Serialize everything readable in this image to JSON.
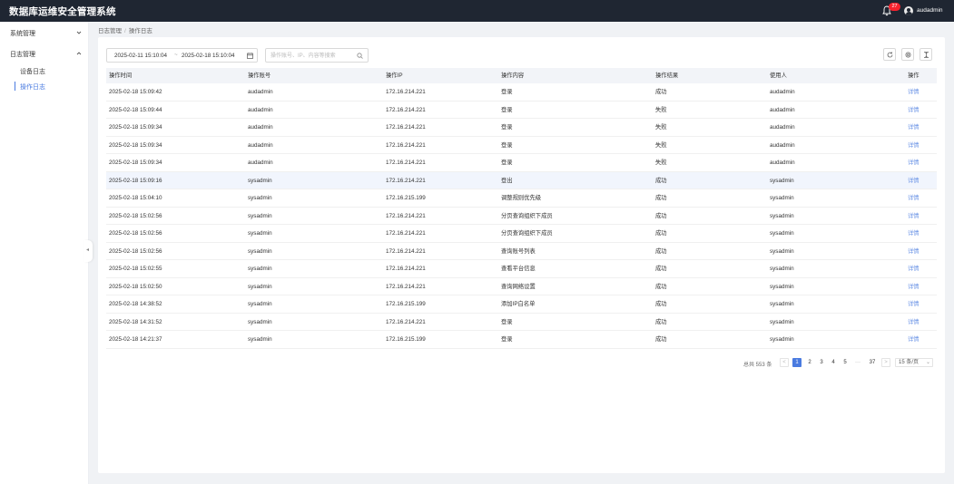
{
  "header": {
    "app_title": "数据库运维安全管理系统",
    "notification_count": "27",
    "username": "audadmin"
  },
  "sidebar": {
    "groups": [
      {
        "label": "系统管理",
        "expanded": false,
        "items": []
      },
      {
        "label": "日志管理",
        "expanded": true,
        "items": [
          {
            "label": "设备日志",
            "active": false
          },
          {
            "label": "操作日志",
            "active": true
          }
        ]
      }
    ],
    "collapse_icon": "chevron-left-icon"
  },
  "breadcrumb": {
    "parent": "日志管理",
    "separator": "/",
    "current": "操作日志"
  },
  "filters": {
    "date_start": "2025-02-11 15:10:04",
    "date_separator": "~",
    "date_end": "2025-02-18 15:10:04",
    "search_placeholder": "操作账号、IP、内容等搜索",
    "search_value": ""
  },
  "toolbar": {
    "refresh_icon": "refresh-icon",
    "settings_icon": "settings-icon",
    "column_height_icon": "column-height-icon"
  },
  "table": {
    "columns": [
      "操作时间",
      "操作账号",
      "操作IP",
      "操作内容",
      "操作结果",
      "使用人",
      "操作"
    ],
    "rows": [
      {
        "time": "2025-02-18 15:09:42",
        "account": "audadmin",
        "ip": "172.16.214.221",
        "content": "登录",
        "result": "成功",
        "user": "audadmin",
        "action": "详情"
      },
      {
        "time": "2025-02-18 15:09:44",
        "account": "audadmin",
        "ip": "172.16.214.221",
        "content": "登录",
        "result": "失败",
        "user": "audadmin",
        "action": "详情"
      },
      {
        "time": "2025-02-18 15:09:34",
        "account": "audadmin",
        "ip": "172.16.214.221",
        "content": "登录",
        "result": "失败",
        "user": "audadmin",
        "action": "详情"
      },
      {
        "time": "2025-02-18 15:09:34",
        "account": "audadmin",
        "ip": "172.16.214.221",
        "content": "登录",
        "result": "失败",
        "user": "audadmin",
        "action": "详情"
      },
      {
        "time": "2025-02-18 15:09:34",
        "account": "audadmin",
        "ip": "172.16.214.221",
        "content": "登录",
        "result": "失败",
        "user": "audadmin",
        "action": "详情"
      },
      {
        "time": "2025-02-18 15:09:16",
        "account": "sysadmin",
        "ip": "172.16.214.221",
        "content": "登出",
        "result": "成功",
        "user": "sysadmin",
        "action": "详情"
      },
      {
        "time": "2025-02-18 15:04:10",
        "account": "sysadmin",
        "ip": "172.16.215.199",
        "content": "调整规则优先级",
        "result": "成功",
        "user": "sysadmin",
        "action": "详情"
      },
      {
        "time": "2025-02-18 15:02:56",
        "account": "sysadmin",
        "ip": "172.16.214.221",
        "content": "分页查询组织下成员",
        "result": "成功",
        "user": "sysadmin",
        "action": "详情"
      },
      {
        "time": "2025-02-18 15:02:56",
        "account": "sysadmin",
        "ip": "172.16.214.221",
        "content": "分页查询组织下成员",
        "result": "成功",
        "user": "sysadmin",
        "action": "详情"
      },
      {
        "time": "2025-02-18 15:02:56",
        "account": "sysadmin",
        "ip": "172.16.214.221",
        "content": "查询账号列表",
        "result": "成功",
        "user": "sysadmin",
        "action": "详情"
      },
      {
        "time": "2025-02-18 15:02:55",
        "account": "sysadmin",
        "ip": "172.16.214.221",
        "content": "查看平台信息",
        "result": "成功",
        "user": "sysadmin",
        "action": "详情"
      },
      {
        "time": "2025-02-18 15:02:50",
        "account": "sysadmin",
        "ip": "172.16.214.221",
        "content": "查询网络设置",
        "result": "成功",
        "user": "sysadmin",
        "action": "详情"
      },
      {
        "time": "2025-02-18 14:38:52",
        "account": "sysadmin",
        "ip": "172.16.215.199",
        "content": "添加IP白名单",
        "result": "成功",
        "user": "sysadmin",
        "action": "详情"
      },
      {
        "time": "2025-02-18 14:31:52",
        "account": "sysadmin",
        "ip": "172.16.214.221",
        "content": "登录",
        "result": "成功",
        "user": "sysadmin",
        "action": "详情"
      },
      {
        "time": "2025-02-18 14:21:37",
        "account": "sysadmin",
        "ip": "172.16.215.199",
        "content": "登录",
        "result": "成功",
        "user": "sysadmin",
        "action": "详情"
      }
    ],
    "highlighted_row": 5
  },
  "pagination": {
    "total_text": "总共 553 条",
    "prev": "<",
    "pages": [
      "1",
      "2",
      "3",
      "4",
      "5"
    ],
    "current": "1",
    "ellipsis": "···",
    "last": "37",
    "next": ">",
    "page_size": "15 条/页"
  },
  "colors": {
    "topbar_bg": "#1f2632",
    "accent": "#4a7be0",
    "link": "#6b94e6",
    "badge": "#f5222d",
    "page_bg": "#f0f2f5"
  }
}
